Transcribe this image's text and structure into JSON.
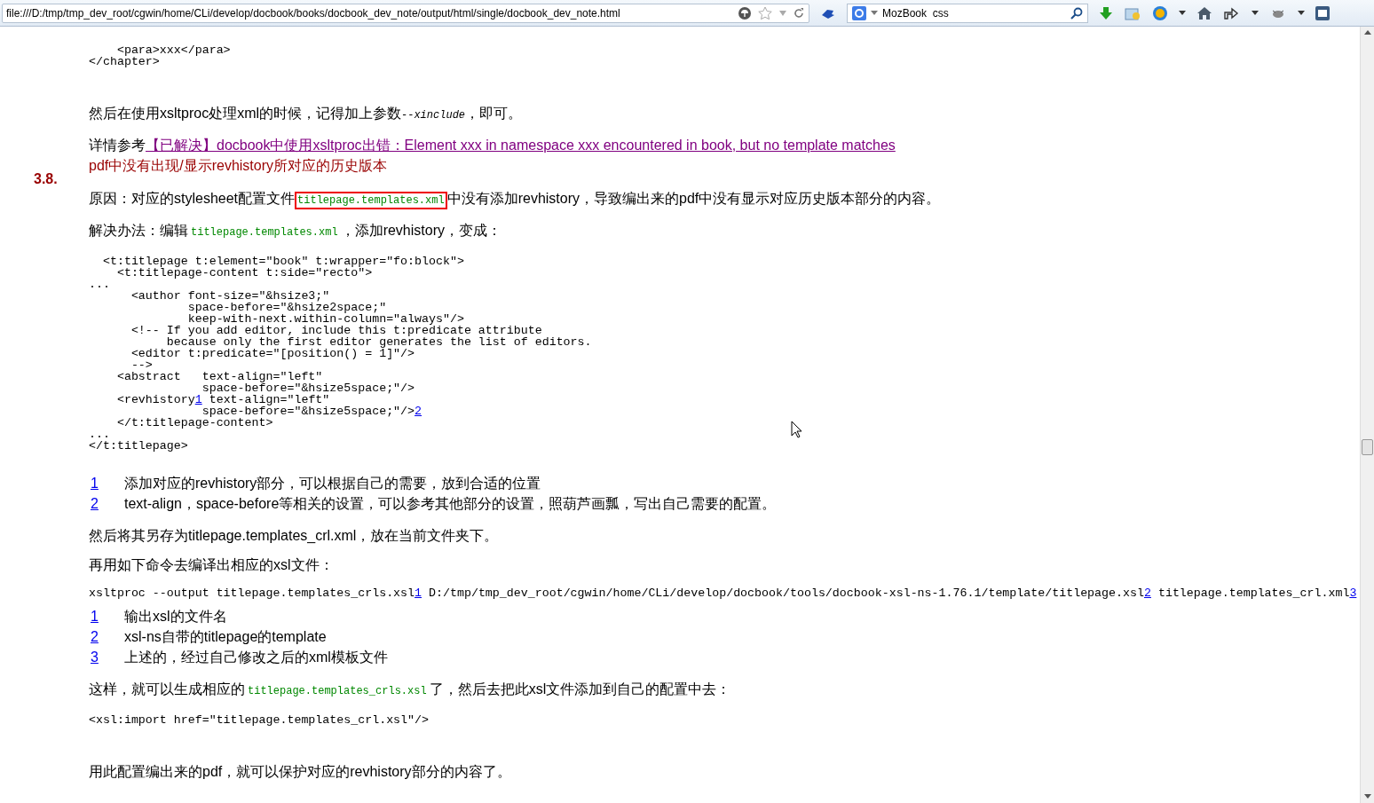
{
  "toolbar": {
    "url": "file:///D:/tmp/tmp_dev_root/cgwin/home/CLi/develop/docbook/books/docbook_dev_note/output/html/single/docbook_dev_note.html",
    "search": {
      "value": "MozBook  css"
    }
  },
  "blocks": [
    {
      "kind": "code",
      "lines": [
        [
          {
            "kind": "text",
            "text": "    <para>xxx</para>"
          }
        ],
        [
          {
            "kind": "text",
            "text": "</chapter>"
          }
        ]
      ]
    },
    {
      "kind": "para",
      "parts": [
        {
          "kind": "text",
          "text": "然后在使用xsltproc处理xml的时候，记得加上参数"
        },
        {
          "kind": "option",
          "text": "--xinclude"
        },
        {
          "kind": "text",
          "text": "，即可。"
        }
      ]
    },
    {
      "kind": "para",
      "parts": [
        {
          "kind": "text",
          "text": "详情参考"
        },
        {
          "kind": "link",
          "text": "【已解决】docbook中使用xsltproc出错：Element xxx in namespace xxx encountered in book, but no template matches"
        }
      ]
    },
    {
      "kind": "heading",
      "title": "pdf中没有出现/显示revhistory所对应的历史版本",
      "number": "3.8."
    },
    {
      "kind": "para",
      "parts": [
        {
          "kind": "text",
          "text": "原因：对应的stylesheet配置文件"
        },
        {
          "kind": "literal",
          "text": "titlepage.templates.xml",
          "highlighted": true
        },
        {
          "kind": "text",
          "text": "中没有添加revhistory，导致编出来的pdf中没有显示对应历史版本部分的内容。"
        }
      ]
    },
    {
      "kind": "para",
      "parts": [
        {
          "kind": "text",
          "text": "解决办法：编辑"
        },
        {
          "kind": "literal",
          "text": "titlepage.templates.xml",
          "highlighted": false
        },
        {
          "kind": "text",
          "text": "，添加revhistory，变成："
        }
      ]
    },
    {
      "kind": "code",
      "lines": [
        [
          {
            "kind": "text",
            "text": "  <t:titlepage t:element=\"book\" t:wrapper=\"fo:block\">"
          }
        ],
        [
          {
            "kind": "text",
            "text": "    <t:titlepage-content t:side=\"recto\">"
          }
        ],
        [
          {
            "kind": "text",
            "text": "..."
          }
        ],
        [
          {
            "kind": "text",
            "text": "      <author font-size=\"&hsize3;\""
          }
        ],
        [
          {
            "kind": "text",
            "text": "              space-before=\"&hsize2space;\""
          }
        ],
        [
          {
            "kind": "text",
            "text": "              keep-with-next.within-column=\"always\"/>"
          }
        ],
        [
          {
            "kind": "text",
            "text": "      <!-- If you add editor, include this t:predicate attribute"
          }
        ],
        [
          {
            "kind": "text",
            "text": "           because only the first editor generates the list of editors."
          }
        ],
        [
          {
            "kind": "text",
            "text": "      <editor t:predicate=\"[position() = 1]\"/>"
          }
        ],
        [
          {
            "kind": "text",
            "text": "      -->"
          }
        ],
        [
          {
            "kind": "text",
            "text": "    <abstract   text-align=\"left\""
          }
        ],
        [
          {
            "kind": "text",
            "text": "                space-before=\"&hsize5space;\"/>"
          }
        ],
        [
          {
            "kind": "text",
            "text": "    <revhistory"
          },
          {
            "kind": "callout",
            "text": "1"
          },
          {
            "kind": "text",
            "text": " text-align=\"left\""
          }
        ],
        [
          {
            "kind": "text",
            "text": "                space-before=\"&hsize5space;\"/>"
          },
          {
            "kind": "callout",
            "text": "2"
          }
        ],
        [
          {
            "kind": "text",
            "text": "    </t:titlepage-content>"
          }
        ],
        [
          {
            "kind": "text",
            "text": "..."
          }
        ],
        [
          {
            "kind": "text",
            "text": "</t:titlepage>"
          }
        ]
      ]
    },
    {
      "kind": "callouts",
      "items": [
        {
          "number": "1",
          "text": "添加对应的revhistory部分，可以根据自己的需要，放到合适的位置"
        },
        {
          "number": "2",
          "text": "text-align，space-before等相关的设置，可以参考其他部分的设置，照葫芦画瓢，写出自己需要的配置。"
        }
      ]
    },
    {
      "kind": "para",
      "parts": [
        {
          "kind": "text",
          "text": "然后将其另存为titlepage.templates_crl.xml，放在当前文件夹下。"
        }
      ]
    },
    {
      "kind": "para",
      "parts": [
        {
          "kind": "text",
          "text": "再用如下命令去编译出相应的xsl文件："
        }
      ]
    },
    {
      "kind": "code",
      "lines": [
        [
          {
            "kind": "text",
            "text": "xsltproc --output titlepage.templates_crls.xsl"
          },
          {
            "kind": "callout",
            "text": "1"
          },
          {
            "kind": "text",
            "text": " D:/tmp/tmp_dev_root/cgwin/home/CLi/develop/docbook/tools/docbook-xsl-ns-1.76.1/template/titlepage.xsl"
          },
          {
            "kind": "callout",
            "text": "2"
          },
          {
            "kind": "text",
            "text": " titlepage.templates_crl.xml"
          },
          {
            "kind": "callout",
            "text": "3"
          }
        ]
      ]
    },
    {
      "kind": "callouts",
      "items": [
        {
          "number": "1",
          "text": "输出xsl的文件名"
        },
        {
          "number": "2",
          "text": "xsl-ns自带的titlepage的template"
        },
        {
          "number": "3",
          "text": "上述的，经过自己修改之后的xml模板文件"
        }
      ]
    },
    {
      "kind": "para",
      "parts": [
        {
          "kind": "text",
          "text": "这样，就可以生成相应的"
        },
        {
          "kind": "literal",
          "text": "titlepage.templates_crls.xsl",
          "highlighted": false
        },
        {
          "kind": "text",
          "text": "了，然后去把此xsl文件添加到自己的配置中去："
        }
      ]
    },
    {
      "kind": "code",
      "lines": [
        [
          {
            "kind": "text",
            "text": "<xsl:import href=\"titlepage.templates_crl.xsl\"/>"
          }
        ]
      ]
    },
    {
      "kind": "para",
      "parts": [
        {
          "kind": "text",
          "text": "用此配置编出来的pdf，就可以保护对应的revhistory部分的内容了。"
        }
      ]
    }
  ]
}
